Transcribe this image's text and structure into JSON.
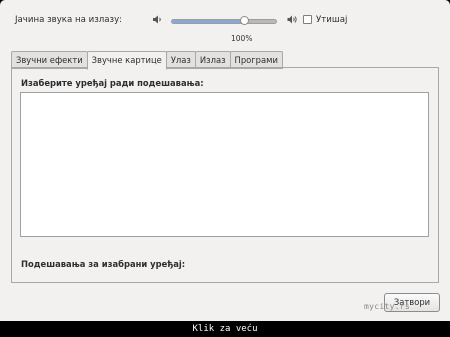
{
  "volume": {
    "label": "Јачина звука на излазу:",
    "level": 0.69,
    "percent_label": "100%",
    "low_icon": "speaker-low-icon",
    "high_icon": "speaker-high-icon",
    "mute_label": "Утишај",
    "mute_checked": false
  },
  "tabs": [
    {
      "label": "Звучни ефекти",
      "active": false
    },
    {
      "label": "Звучне картице",
      "active": true
    },
    {
      "label": "Улаз",
      "active": false
    },
    {
      "label": "Излаз",
      "active": false
    },
    {
      "label": "Програми",
      "active": false
    }
  ],
  "panel": {
    "choose_label": "Изаберите уређај ради подешавања:",
    "settings_label": "Подешавања за изабрани уређај:"
  },
  "buttons": {
    "close": "Затвори"
  },
  "watermark": "mycity.rs",
  "footer": {
    "text": "Klik za veću"
  },
  "colors": {
    "window_bg": "#f2f1f0",
    "slider_fill": "#8aa8d6",
    "bar_bg": "#000000"
  }
}
